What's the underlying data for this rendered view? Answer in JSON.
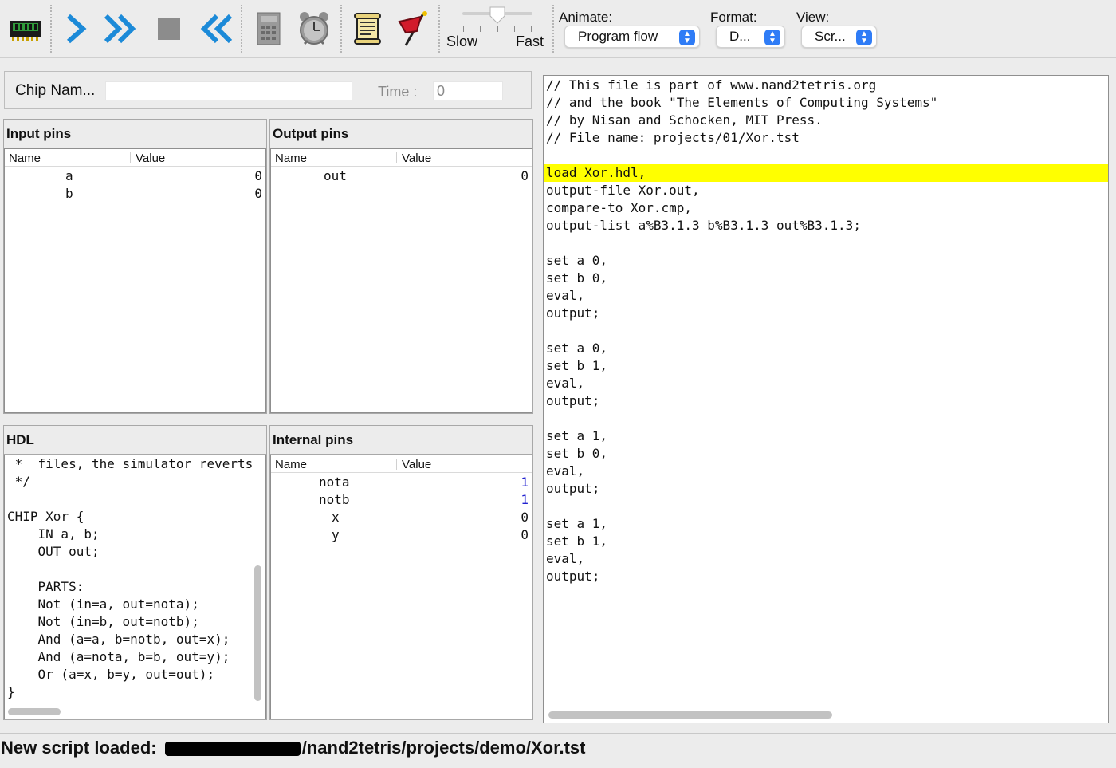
{
  "toolbar": {
    "buttons": [
      {
        "name": "load-chip-icon"
      },
      {
        "name": "single-step-icon"
      },
      {
        "name": "run-icon"
      },
      {
        "name": "stop-icon"
      },
      {
        "name": "reset-icon"
      },
      {
        "name": "eval-calculator-icon"
      },
      {
        "name": "clock-icon"
      },
      {
        "name": "script-icon"
      },
      {
        "name": "breakpoint-flag-icon"
      }
    ],
    "speed": {
      "slow_label": "Slow",
      "fast_label": "Fast",
      "level": 0.5
    },
    "animate": {
      "label": "Animate:",
      "value": "Program flow"
    },
    "format": {
      "label": "Format:",
      "value": "D..."
    },
    "view": {
      "label": "View:",
      "value": "Scr..."
    }
  },
  "chip": {
    "name_label": "Chip Nam...",
    "name_value": "",
    "time_label": "Time :",
    "time_value": "0"
  },
  "input_pins": {
    "title": "Input pins",
    "col_name": "Name",
    "col_value": "Value",
    "rows": [
      {
        "name": "a",
        "value": "0"
      },
      {
        "name": "b",
        "value": "0"
      }
    ]
  },
  "output_pins": {
    "title": "Output pins",
    "col_name": "Name",
    "col_value": "Value",
    "rows": [
      {
        "name": "out",
        "value": "0"
      }
    ]
  },
  "hdl": {
    "title": "HDL",
    "code": " *  files, the simulator reverts\n */\n\nCHIP Xor {\n    IN a, b;\n    OUT out;\n\n    PARTS:\n    Not (in=a, out=nota);\n    Not (in=b, out=notb);\n    And (a=a, b=notb, out=x);\n    And (a=nota, b=b, out=y);\n    Or (a=x, b=y, out=out);\n}"
  },
  "internal_pins": {
    "title": "Internal pins",
    "col_name": "Name",
    "col_value": "Value",
    "rows": [
      {
        "name": "nota",
        "value": "1"
      },
      {
        "name": "notb",
        "value": "1"
      },
      {
        "name": "x",
        "value": "0"
      },
      {
        "name": "y",
        "value": "0"
      }
    ]
  },
  "script": {
    "highlight_color": "#ffff00",
    "lines": [
      "// This file is part of www.nand2tetris.org",
      "// and the book \"The Elements of Computing Systems\"",
      "// by Nisan and Schocken, MIT Press.",
      "// File name: projects/01/Xor.tst",
      "",
      "load Xor.hdl,",
      "output-file Xor.out,",
      "compare-to Xor.cmp,",
      "output-list a%B3.1.3 b%B3.1.3 out%B3.1.3;",
      "",
      "set a 0,",
      "set b 0,",
      "eval,",
      "output;",
      "",
      "set a 0,",
      "set b 1,",
      "eval,",
      "output;",
      "",
      "set a 1,",
      "set b 0,",
      "eval,",
      "output;",
      "",
      "set a 1,",
      "set b 1,",
      "eval,",
      "output;"
    ]
  },
  "status": {
    "prefix": "New script loaded: ",
    "path_suffix": "/nand2tetris/projects/demo/Xor.tst"
  }
}
